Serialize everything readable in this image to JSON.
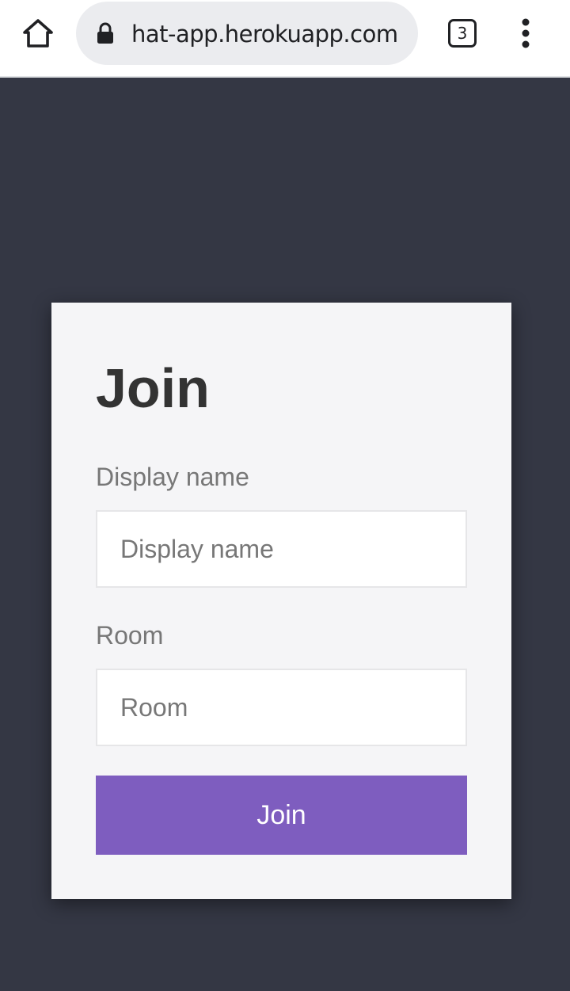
{
  "browser": {
    "url": "hat-app.herokuapp.com",
    "tab_count": "3",
    "icons": [
      "home-icon",
      "lock-icon",
      "tab-switcher-icon",
      "more-vert-icon"
    ]
  },
  "join_form": {
    "title": "Join",
    "display_name_label": "Display name",
    "display_name_placeholder": "Display name",
    "display_name_value": "",
    "room_label": "Room",
    "room_placeholder": "Room",
    "room_value": "",
    "submit_label": "Join"
  },
  "colors": {
    "page_background": "#343744",
    "card_background": "#f5f5f7",
    "button_background": "#7e5dbf",
    "button_text": "#ffffff",
    "title_text": "#333333",
    "label_text": "#777777"
  }
}
